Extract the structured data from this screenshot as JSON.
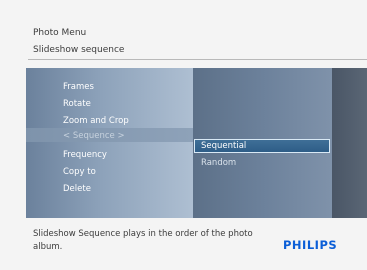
{
  "header": {
    "title": "Photo Menu",
    "subtitle": "Slideshow sequence"
  },
  "menu": {
    "items": [
      {
        "label": "Frames",
        "selected": false
      },
      {
        "label": "Rotate",
        "selected": false
      },
      {
        "label": "Zoom and Crop",
        "selected": false
      },
      {
        "label": "< Sequence >",
        "selected": true
      },
      {
        "label": "Frequency",
        "selected": false
      },
      {
        "label": "Copy to",
        "selected": false
      },
      {
        "label": "Delete",
        "selected": false
      }
    ]
  },
  "submenu": {
    "items": [
      {
        "label": "Sequential",
        "selected": true
      },
      {
        "label": "Random",
        "selected": false
      }
    ]
  },
  "footer": {
    "help_text": "Slideshow Sequence plays in the order of the photo album.",
    "brand": "PHILIPS"
  },
  "colors": {
    "brand": "#0b5ed7",
    "highlight": "#2e5d87"
  }
}
